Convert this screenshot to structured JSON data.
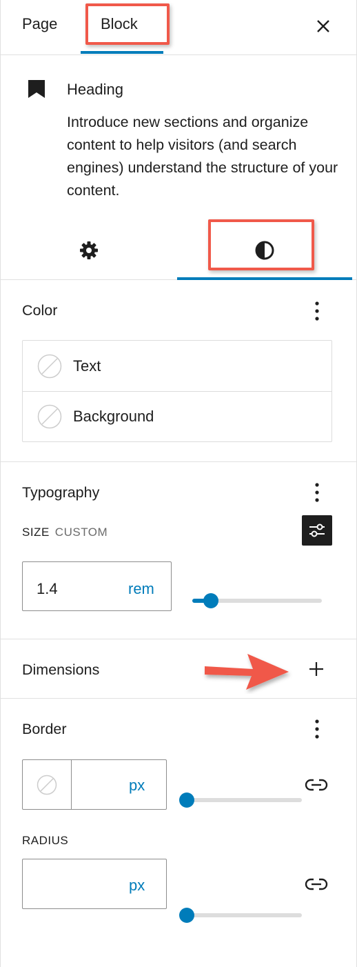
{
  "header": {
    "tabs": [
      {
        "label": "Page"
      },
      {
        "label": "Block"
      }
    ],
    "close_icon": "close-icon"
  },
  "block": {
    "icon": "bookmark-icon",
    "title": "Heading",
    "description": "Introduce new sections and organize content to help visitors (and search engines) understand the structure of your content."
  },
  "subtabs": {
    "settings_icon": "gear-icon",
    "styles_icon": "contrast-icon"
  },
  "color": {
    "title": "Color",
    "items": [
      {
        "label": "Text"
      },
      {
        "label": "Background"
      }
    ]
  },
  "typography": {
    "title": "Typography",
    "size_label": "SIZE",
    "size_mode": "CUSTOM",
    "size_value": "1.4",
    "size_unit": "rem",
    "size_slider_fraction": 0.15
  },
  "dimensions": {
    "title": "Dimensions"
  },
  "border": {
    "title": "Border",
    "width_value": "",
    "width_unit": "px",
    "width_slider_fraction": 0,
    "radius_label": "RADIUS",
    "radius_value": "",
    "radius_unit": "px",
    "radius_slider_fraction": 0
  },
  "colors": {
    "accent": "#007cba",
    "annotation": "#f0594a",
    "text": "#1e1e1e"
  }
}
